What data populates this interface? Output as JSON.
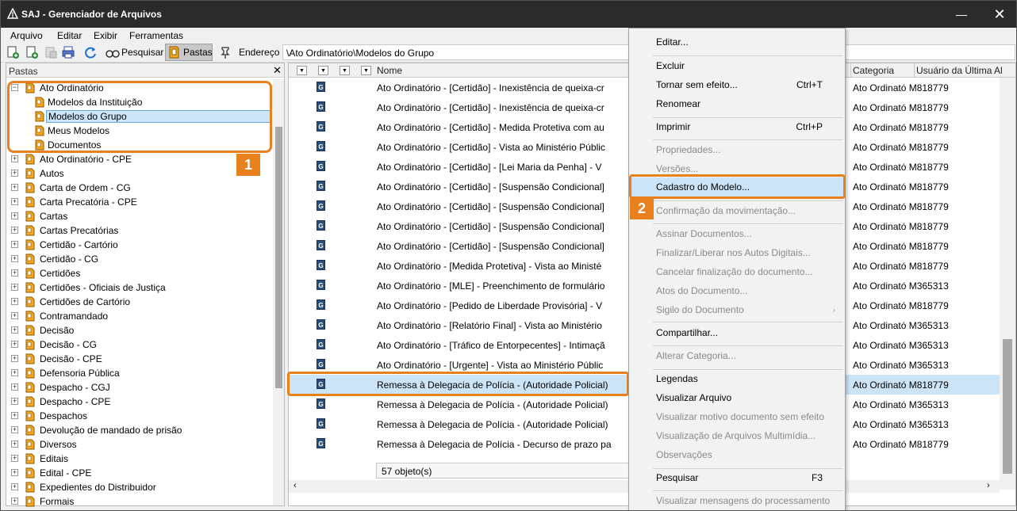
{
  "window": {
    "title": "SAJ - Gerenciador de Arquivos",
    "minimize": "—",
    "close": "✕"
  },
  "menu": [
    "Arquivo",
    "Editar",
    "Exibir",
    "Ferramentas"
  ],
  "toolbar": {
    "search_label": "Pesquisar",
    "folders_label": "Pastas",
    "address_label": "Endereço",
    "address_value": "\\Ato Ordinatório\\Modelos do Grupo"
  },
  "folders": {
    "header": "Pastas",
    "close": "✕",
    "expanded": {
      "label": "Ato Ordinatório",
      "children": [
        "Modelos da Instituição",
        "Modelos do Grupo",
        "Meus Modelos",
        "Documentos"
      ],
      "selected_index": 1
    },
    "items": [
      "Ato Ordinatório - CPE",
      "Autos",
      "Carta de Ordem - CG",
      "Carta Precatória - CPE",
      "Cartas",
      "Cartas Precatórias",
      "Certidão - Cartório",
      "Certidão - CG",
      "Certidões",
      "Certidões - Oficiais de Justiça",
      "Certidões de Cartório",
      "Contramandado",
      "Decisão",
      "Decisão - CG",
      "Decisão - CPE",
      "Defensoria Pública",
      "Despacho - CGJ",
      "Despacho - CPE",
      "Despachos",
      "Devolução de mandado de prisão",
      "Diversos",
      "Editais",
      "Edital - CPE",
      "Expedientes do Distribuidor",
      "Formais"
    ]
  },
  "grid": {
    "columns": {
      "name": "Nome",
      "category": "Categoria",
      "user": "Usuário da Última Al"
    },
    "rows": [
      {
        "name": "Ato Ordinatório - [Certidão] - Inexistência de queixa-cr",
        "category": "Ato Ordinató M818779"
      },
      {
        "name": "Ato Ordinatório - [Certidão] - Inexistência de queixa-cr",
        "category": "Ato Ordinató M818779"
      },
      {
        "name": "Ato Ordinatório - [Certidão] - Medida Protetiva com au",
        "category": "Ato Ordinató M818779"
      },
      {
        "name": "Ato Ordinatório - [Certidão] - Vista ao Ministério Públic",
        "category": "Ato Ordinató M818779"
      },
      {
        "name": "Ato Ordinatório - [Certidão] - [Lei Maria da Penha] - V",
        "category": "Ato Ordinató M818779"
      },
      {
        "name": "Ato Ordinatório - [Certidão] - [Suspensão Condicional]",
        "category": "Ato Ordinató M818779"
      },
      {
        "name": "Ato Ordinatório - [Certidão] - [Suspensão Condicional]",
        "category": "Ato Ordinató M818779"
      },
      {
        "name": "Ato Ordinatório - [Certidão] - [Suspensão Condicional]",
        "category": "Ato Ordinató M818779"
      },
      {
        "name": "Ato Ordinatório - [Certidão] - [Suspensão Condicional]",
        "category": "Ato Ordinató M818779"
      },
      {
        "name": "Ato Ordinatório - [Medida Protetiva] - Vista ao Ministé",
        "category": "Ato Ordinató M818779"
      },
      {
        "name": "Ato Ordinatório - [MLE] - Preenchimento de formulário",
        "category": "Ato Ordinató M365313"
      },
      {
        "name": "Ato Ordinatório - [Pedido de Liberdade Provisória] - V",
        "category": "Ato Ordinató M818779"
      },
      {
        "name": "Ato Ordinatório - [Relatório Final] - Vista ao Ministério",
        "category": "Ato Ordinató M365313"
      },
      {
        "name": "Ato Ordinatório - [Tráfico de Entorpecentes] - Intimaçã",
        "category": "Ato Ordinató M365313"
      },
      {
        "name": "Ato Ordinatório - [Urgente] - Vista ao Ministério Públic",
        "category": "Ato Ordinató M365313"
      },
      {
        "name": "Remessa à Delegacia de Polícia - (Autoridade Policial)",
        "category": "Ato Ordinató M818779"
      },
      {
        "name": "Remessa à Delegacia de Polícia - (Autoridade Policial)",
        "category": "Ato Ordinató M365313"
      },
      {
        "name": "Remessa à Delegacia de Polícia - (Autoridade Policial)",
        "category": "Ato Ordinató M365313"
      },
      {
        "name": "Remessa à Delegacia de Polícia - Decurso de prazo pa",
        "category": "Ato Ordinató M818779"
      }
    ],
    "selected_row": 15,
    "status": "57 objeto(s)"
  },
  "context_menu": {
    "items": [
      {
        "label": "Editar...",
        "disabled": false
      },
      {
        "label": "Excluir",
        "disabled": false
      },
      {
        "label": "Tornar sem efeito...",
        "shortcut": "Ctrl+T",
        "disabled": false
      },
      {
        "label": "Renomear",
        "disabled": false
      },
      {
        "label": "Imprimir",
        "shortcut": "Ctrl+P",
        "disabled": false
      },
      {
        "label": "Propriedades...",
        "disabled": true
      },
      {
        "label": "Versões...",
        "disabled": true
      },
      {
        "label": "Cadastro do Modelo...",
        "disabled": false,
        "highlighted": true
      },
      {
        "label": "Confirmação da movimentação...",
        "disabled": true
      },
      {
        "label": "Assinar Documentos...",
        "disabled": true
      },
      {
        "label": "Finalizar/Liberar nos Autos Digitais...",
        "disabled": true
      },
      {
        "label": "Cancelar finalização do documento...",
        "disabled": true
      },
      {
        "label": "Atos do Documento...",
        "disabled": true
      },
      {
        "label": "Sigilo do Documento",
        "disabled": true,
        "submenu": true
      },
      {
        "label": "Compartilhar...",
        "disabled": false
      },
      {
        "label": "Alterar Categoria...",
        "disabled": true
      },
      {
        "label": "Legendas",
        "disabled": false
      },
      {
        "label": "Visualizar Arquivo",
        "disabled": false
      },
      {
        "label": "Visualizar motivo documento sem efeito",
        "disabled": true
      },
      {
        "label": "Visualização de Arquivos Multimídia...",
        "disabled": true
      },
      {
        "label": "Observações",
        "disabled": true
      },
      {
        "label": "Pesquisar",
        "shortcut": "F3",
        "disabled": false
      },
      {
        "label": "Visualizar mensagens do processamento",
        "disabled": true
      }
    ]
  },
  "callouts": [
    "1",
    "2"
  ],
  "colors": {
    "accent": "#e8801e",
    "selection": "#cce4f7",
    "titlebar": "#2b2b2b"
  }
}
